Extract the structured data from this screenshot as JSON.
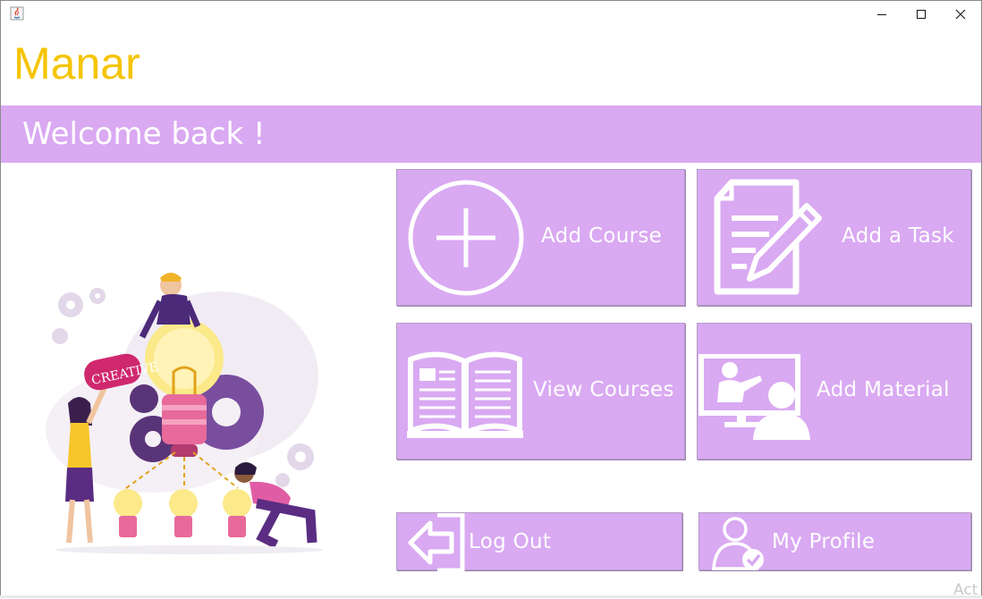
{
  "colors": {
    "brand": "#f5c400",
    "banner": "#d9a9f2",
    "tile": "#d9a9f2",
    "icon": "#ffffff"
  },
  "window": {
    "controls": {
      "minimize_icon": "minimize-icon",
      "maximize_icon": "maximize-icon",
      "close_icon": "close-icon"
    }
  },
  "header": {
    "app_name": "Manar"
  },
  "banner": {
    "welcome_text": "Welcome back !"
  },
  "actions": {
    "add_course": {
      "label": "Add Course",
      "icon": "plus-circle-icon"
    },
    "add_task": {
      "label": "Add a Task",
      "icon": "document-pencil-icon"
    },
    "view_courses": {
      "label": "View Courses",
      "icon": "open-book-icon"
    },
    "add_material": {
      "label": "Add Material",
      "icon": "presentation-icon"
    },
    "log_out": {
      "label": "Log Out",
      "icon": "logout-arrow-icon"
    },
    "my_profile": {
      "label": "My Profile",
      "icon": "user-check-icon"
    }
  },
  "illustration": {
    "badge_text": "CREATIVE"
  },
  "watermark": {
    "text": "Act"
  }
}
